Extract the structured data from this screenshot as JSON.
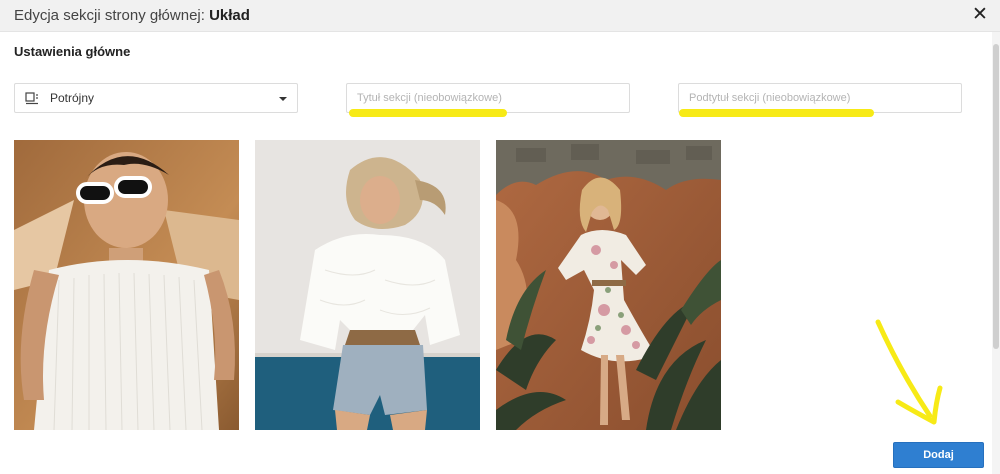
{
  "header": {
    "title_prefix": "Edycja sekcji strony głównej: ",
    "title_strong": "Układ",
    "close_icon": "close-icon"
  },
  "main": {
    "section_heading": "Ustawienia główne",
    "layout_select": {
      "icon": "layout-icon",
      "value": "Potrójny"
    },
    "title_input": {
      "value": "",
      "placeholder": "Tytuł sekcji (nieobowiązkowe)"
    },
    "subtitle_input": {
      "value": "",
      "placeholder": "Podtytuł sekcji (nieobowiązkowe)"
    },
    "photos": [
      {
        "name": "photo-woman-sunglasses-white-top"
      },
      {
        "name": "photo-woman-white-blouse-denim-shorts"
      },
      {
        "name": "photo-woman-floral-dress-wall"
      }
    ]
  },
  "footer": {
    "add_label": "Dodaj"
  },
  "colors": {
    "accent": "#2f7fd1",
    "highlight": "#f7ea16",
    "header_bg": "#f1f1f1"
  }
}
